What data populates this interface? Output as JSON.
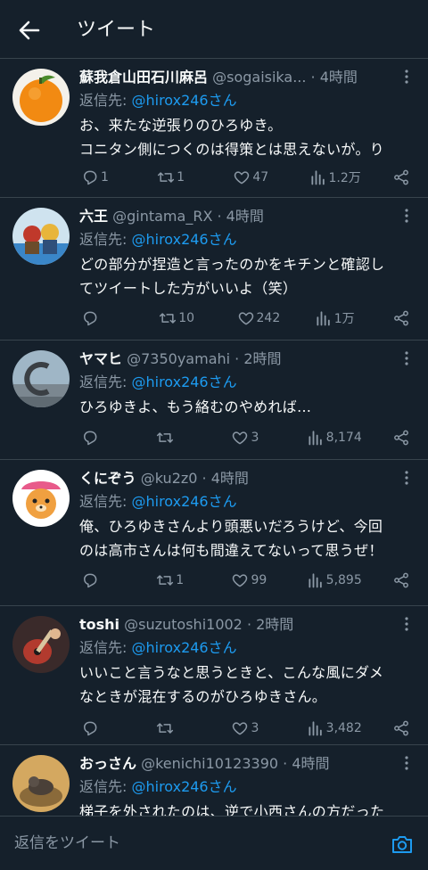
{
  "header": {
    "title": "ツイート"
  },
  "colors": {
    "background": "#15202b",
    "text": "#f7f9f9",
    "muted": "#8b98a5",
    "accent": "#1d9bf0",
    "divider": "#38444d"
  },
  "icons": {
    "back": "arrow-left-icon",
    "more": "more-vertical-icon",
    "reply": "reply-icon",
    "retweet": "retweet-icon",
    "like": "heart-icon",
    "views": "views-bar-icon",
    "share": "share-icon",
    "camera": "camera-icon"
  },
  "tweets": [
    {
      "display_name": "蘇我倉山田石川麻呂",
      "handle": "@sogaisika...",
      "time": " · 4時間",
      "reply_prefix": "返信先: ",
      "reply_to": "@hirox246さん",
      "text_lines": [
        "お、来たな逆張りのひろゆき。",
        "コニタン側につくのは得策とは思えないが。り"
      ],
      "stats": {
        "replies": "1",
        "retweets": "1",
        "likes": "47",
        "views": "1.2万"
      }
    },
    {
      "display_name": "六王",
      "handle": "@gintama_RX",
      "time": " · 4時間",
      "reply_prefix": "返信先: ",
      "reply_to": "@hirox246さん",
      "text_lines": [
        "どの部分が捏造と言ったのかをキチンと確認し",
        "てツイートした方がいいよ（笑）"
      ],
      "stats": {
        "replies": "",
        "retweets": "10",
        "likes": "242",
        "views": "1万"
      }
    },
    {
      "display_name": "ヤマヒ",
      "handle": "@7350yamahi",
      "time": " · 2時間",
      "reply_prefix": "返信先: ",
      "reply_to": "@hirox246さん",
      "text_lines": [
        "ひろゆきよ、もう絡むのやめれば…"
      ],
      "stats": {
        "replies": "",
        "retweets": "",
        "likes": "3",
        "views": "8,174"
      }
    },
    {
      "display_name": "くにぞう",
      "handle": "@ku2z0",
      "time": " · 4時間",
      "reply_prefix": "返信先: ",
      "reply_to": "@hirox246さん",
      "text_lines": [
        "俺、ひろゆきさんより頭悪いだろうけど、今回",
        "のは高市さんは何も間違えてないって思うぜ！"
      ],
      "stats": {
        "replies": "",
        "retweets": "1",
        "likes": "99",
        "views": "5,895"
      }
    },
    {
      "display_name": "toshi",
      "handle": "@suzutoshi1002",
      "time": " · 2時間",
      "reply_prefix": "返信先: ",
      "reply_to": "@hirox246さん",
      "text_lines": [
        "いいこと言うなと思うときと、こんな風にダメ",
        "なときが混在するのがひろゆきさん。"
      ],
      "stats": {
        "replies": "",
        "retweets": "",
        "likes": "3",
        "views": "3,482"
      }
    },
    {
      "display_name": "おっさん",
      "handle": "@kenichi10123390",
      "time": " · 4時間",
      "reply_prefix": "返信先: ",
      "reply_to": "@hirox246さん",
      "text_lines": [
        "梯子を外されたのは、逆で小西さんの方だった"
      ],
      "stats": {
        "replies": "",
        "retweets": "",
        "likes": "",
        "views": ""
      }
    }
  ],
  "composer": {
    "placeholder": "返信をツイート"
  }
}
